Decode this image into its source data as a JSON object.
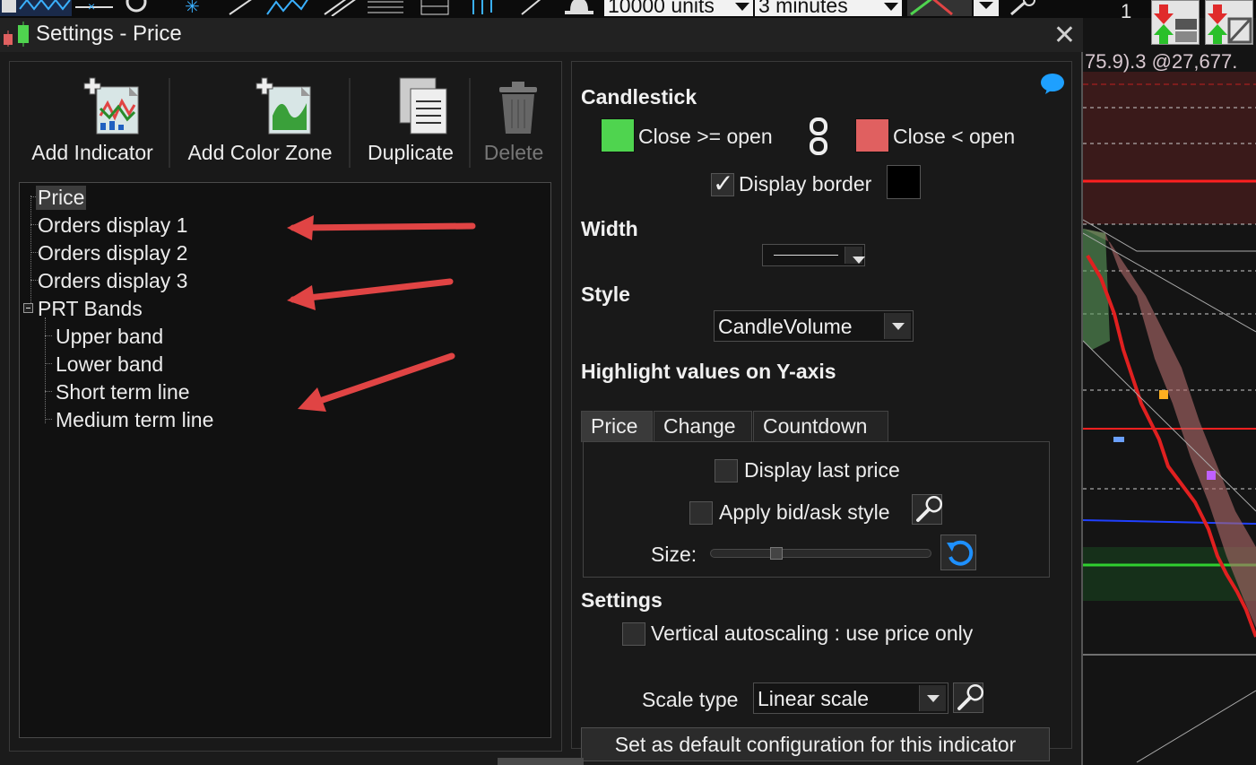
{
  "toolbar": {
    "units_value": "10000 units",
    "timeframe_value": "3 minutes",
    "counter_value": "1"
  },
  "dialog": {
    "title": "Settings - Price",
    "close_symbol": "✕"
  },
  "left_toolbar": {
    "add_indicator": "Add Indicator",
    "add_color_zone": "Add Color Zone",
    "duplicate": "Duplicate",
    "delete": "Delete"
  },
  "tree": {
    "items": [
      {
        "label": "Price"
      },
      {
        "label": "Orders display 1"
      },
      {
        "label": "Orders display 2"
      },
      {
        "label": "Orders display 3"
      },
      {
        "label": "PRT Bands"
      },
      {
        "label": "Upper band"
      },
      {
        "label": "Lower band"
      },
      {
        "label": "Short term line"
      },
      {
        "label": "Medium term line"
      }
    ]
  },
  "settings": {
    "candlestick_heading": "Candlestick",
    "close_ge_open": "Close >= open",
    "close_lt_open": "Close < open",
    "display_border": "Display border",
    "width_heading": "Width",
    "style_heading": "Style",
    "style_value": "CandleVolume",
    "highlight_heading": "Highlight values on Y-axis",
    "tabs": [
      "Price",
      "Change",
      "Countdown"
    ],
    "display_last_price": "Display last price",
    "apply_bid_ask": "Apply bid/ask style",
    "size_label": "Size:",
    "settings_heading": "Settings",
    "vertical_autoscaling": "Vertical autoscaling : use price only",
    "scale_type_label": "Scale type",
    "scale_type_value": "Linear scale",
    "set_default_button": "Set as default configuration for this indicator"
  },
  "colors": {
    "bull": "#4fd44f",
    "bear": "#e06060",
    "border": "#000000",
    "annotation_arrow": "#e04444"
  },
  "chart": {
    "price_readout": "75.9).3 @27,677."
  }
}
